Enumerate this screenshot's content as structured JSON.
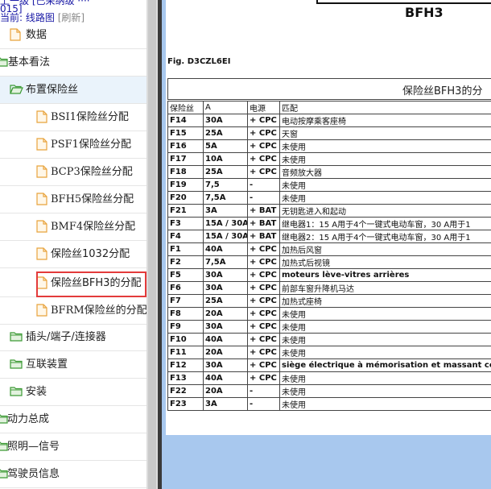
{
  "sidebar": {
    "header_line1": "上一级 [已采纳级 ····",
    "header_line2": "015]",
    "current_prefix": "当前: ",
    "current_link": "线路图",
    "refresh": "[刷新]",
    "items": [
      {
        "label": "数据",
        "icon": "document-icon"
      },
      {
        "label": "基本看法",
        "icon": "folder-icon"
      },
      {
        "label": "布置保险丝",
        "icon": "folder-open-icon"
      },
      {
        "label": "BSI1保险丝分配",
        "icon": "document-icon"
      },
      {
        "label": "PSF1保险丝分配",
        "icon": "document-icon"
      },
      {
        "label": "BCP3保险丝分配",
        "icon": "document-icon"
      },
      {
        "label": "BFH5保险丝分配",
        "icon": "document-icon"
      },
      {
        "label": "BMF4保险丝分配",
        "icon": "document-icon"
      },
      {
        "label": "保险丝1032分配",
        "icon": "document-icon"
      },
      {
        "label": "保险丝BFH3的分配",
        "icon": "document-icon"
      },
      {
        "label": "BFRM保险丝的分配",
        "icon": "document-icon"
      },
      {
        "label": "插头/端子/连接器",
        "icon": "folder-icon"
      },
      {
        "label": "互联装置",
        "icon": "folder-icon"
      },
      {
        "label": "安装",
        "icon": "folder-icon"
      },
      {
        "label": "动力总成",
        "icon": "folder-icon"
      },
      {
        "label": "照明—信号",
        "icon": "folder-icon"
      },
      {
        "label": "驾驶员信息",
        "icon": "folder-icon"
      }
    ]
  },
  "doc": {
    "code": "BFH3",
    "figure": "Fig. D3CZL6EI",
    "title": "保险丝BFH3的分",
    "headers": [
      "保险丝",
      "A",
      "电源",
      "匹配"
    ],
    "rows": [
      [
        "F14",
        "30A",
        "+ CPC",
        "电动按摩乘客座椅"
      ],
      [
        "F15",
        "25A",
        "+ CPC",
        "天窗"
      ],
      [
        "F16",
        "5A",
        "+ CPC",
        "未使用"
      ],
      [
        "F17",
        "10A",
        "+ CPC",
        "未使用"
      ],
      [
        "F18",
        "25A",
        "+ CPC",
        "音频放大器"
      ],
      [
        "F19",
        "7,5",
        "-",
        "未使用"
      ],
      [
        "F20",
        "7,5A",
        "-",
        "未使用"
      ],
      [
        "F21",
        "3A",
        "+ BAT",
        "无钥匙进入和起动"
      ],
      [
        "F3",
        "15A / 30A",
        "+ BAT",
        "继电器1：15 A用于4个一键式电动车窗，30 A用于1"
      ],
      [
        "F4",
        "15A / 30A",
        "+ BAT",
        "继电器2：15 A用于4个一键式电动车窗，30 A用于1"
      ],
      [
        "F1",
        "40A",
        "+ CPC",
        "加热后风窗"
      ],
      [
        "F2",
        "7,5A",
        "+ CPC",
        "加热式后视镜"
      ],
      [
        "F5",
        "30A",
        "+ CPC",
        "moteurs lève-vitres arrières"
      ],
      [
        "F6",
        "30A",
        "+ CPC",
        "前部车窗升降机马达"
      ],
      [
        "F7",
        "25A",
        "+ CPC",
        "加热式座椅"
      ],
      [
        "F8",
        "20A",
        "+ CPC",
        "未使用"
      ],
      [
        "F9",
        "30A",
        "+ CPC",
        "未使用"
      ],
      [
        "F10",
        "40A",
        "+ CPC",
        "未使用"
      ],
      [
        "F11",
        "20A",
        "+ CPC",
        "未使用"
      ],
      [
        "F12",
        "30A",
        "+ CPC",
        "siège électrique à mémorisation et massant condu"
      ],
      [
        "F13",
        "40A",
        "+ CPC",
        "未使用"
      ],
      [
        "F22",
        "20A",
        "-",
        "未使用"
      ],
      [
        "F23",
        "3A",
        "-",
        "未使用"
      ]
    ]
  },
  "colors": {
    "highlight_border": "#e33b3b",
    "selected_row_bg": "#eaf3fb",
    "viewer_bg": "#a8c8ee",
    "folder_green": "#3c9a35",
    "doc_orange": "#e8a33c"
  }
}
